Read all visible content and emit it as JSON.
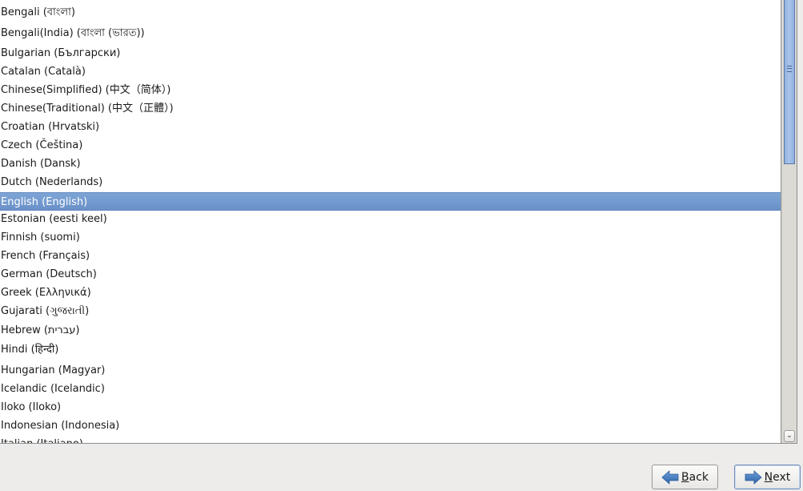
{
  "language_list": {
    "items": [
      {
        "label": "Bengali (বাংলা)",
        "selected": false
      },
      {
        "label": "Bengali(India) (বাংলা (ভারত))",
        "selected": false
      },
      {
        "label": "Bulgarian (Български)",
        "selected": false
      },
      {
        "label": "Catalan (Català)",
        "selected": false
      },
      {
        "label": "Chinese(Simplified) (中文（简体）)",
        "selected": false
      },
      {
        "label": "Chinese(Traditional) (中文（正體）)",
        "selected": false
      },
      {
        "label": "Croatian (Hrvatski)",
        "selected": false
      },
      {
        "label": "Czech (Čeština)",
        "selected": false
      },
      {
        "label": "Danish (Dansk)",
        "selected": false
      },
      {
        "label": "Dutch (Nederlands)",
        "selected": false
      },
      {
        "label": "English (English)",
        "selected": true
      },
      {
        "label": "Estonian (eesti keel)",
        "selected": false
      },
      {
        "label": "Finnish (suomi)",
        "selected": false
      },
      {
        "label": "French (Français)",
        "selected": false
      },
      {
        "label": "German (Deutsch)",
        "selected": false
      },
      {
        "label": "Greek (Ελληνικά)",
        "selected": false
      },
      {
        "label": "Gujarati (ગુજરાતી)",
        "selected": false
      },
      {
        "label": "Hebrew (עברית)",
        "selected": false
      },
      {
        "label": "Hindi (हिन्दी)",
        "selected": false
      },
      {
        "label": "Hungarian (Magyar)",
        "selected": false
      },
      {
        "label": "Icelandic (Icelandic)",
        "selected": false
      },
      {
        "label": "Iloko (Iloko)",
        "selected": false
      },
      {
        "label": "Indonesian (Indonesia)",
        "selected": false
      },
      {
        "label": "Italian (Italiano)",
        "selected": false
      }
    ],
    "selected_value": "English (English)"
  },
  "scrollbar": {
    "position_fraction": 0.0,
    "visible_fraction": 0.37,
    "down_arrow_glyph": "⌄"
  },
  "buttons": {
    "back": {
      "mnemonic": "B",
      "rest": "ack",
      "icon": "arrow-left-icon"
    },
    "next": {
      "mnemonic": "N",
      "rest": "ext",
      "icon": "arrow-right-icon"
    }
  },
  "colors": {
    "selection": "#7399d0",
    "arrow_icon": "#3d73b8",
    "scroll_thumb": "#9dbbe6"
  }
}
